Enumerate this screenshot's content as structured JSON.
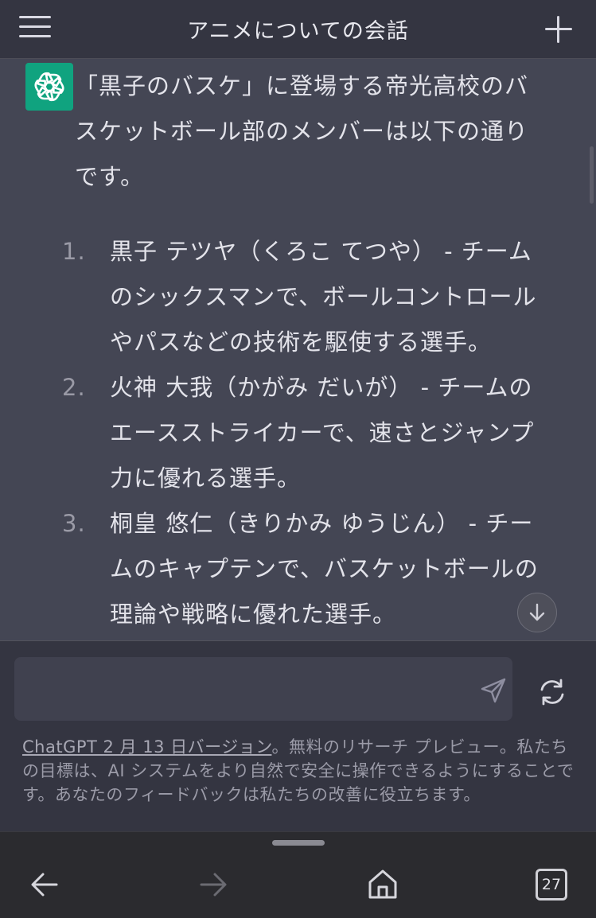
{
  "header": {
    "title": "アニメについての会話",
    "menu_icon": "hamburger-menu-icon",
    "new_chat_icon": "plus-icon"
  },
  "message": {
    "avatar_icon": "openai-logo-icon",
    "intro": "「黒子のバスケ」に登場する帝光高校のバスケットボール部のメンバーは以下の通りです。",
    "members": [
      {
        "number": "1.",
        "text": "黒子 テツヤ（くろこ てつや） - チームのシックスマンで、ボールコントロールやパスなどの技術を駆使する選手。"
      },
      {
        "number": "2.",
        "text": "火神 大我（かがみ だいが） - チームのエースストライカーで、速さとジャンプ力に優れる選手。"
      },
      {
        "number": "3.",
        "text": "桐皇 悠仁（きりかみ ゆうじん） - チームのキャプテンで、バスケットボールの理論や戦略に優れた選手。"
      }
    ],
    "scroll_down_icon": "arrow-down-icon"
  },
  "composer": {
    "input_value": "",
    "send_icon": "send-icon",
    "regenerate_icon": "refresh-icon"
  },
  "footer": {
    "link_text": "ChatGPT 2 月 13 日バージョン",
    "note": "。無料のリサーチ プレビュー。私たちの目標は、AI システムをより自然で安全に操作できるようにすることです。あなたのフィードバックは私たちの改善に役立ちます。"
  },
  "browser": {
    "back_icon": "arrow-left-icon",
    "forward_icon": "arrow-right-icon",
    "home_icon": "home-icon",
    "tab_count": "27"
  },
  "colors": {
    "background": "#343541",
    "message_background": "#444654",
    "accent": "#10a37f",
    "browser_bar": "#2b2b2f"
  }
}
